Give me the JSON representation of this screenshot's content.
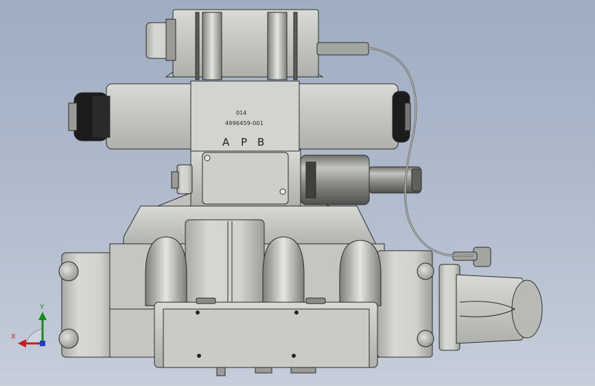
{
  "labels": {
    "part_line_1": "014",
    "part_line_2": "4996459-001",
    "port_a": "A",
    "port_p": "P",
    "port_b": "B"
  },
  "axes": {
    "y": "Y",
    "x": "X"
  },
  "colors": {
    "background_top": "#9fadc2",
    "background_bottom": "#c6ceda",
    "metal": "#c9cbc7",
    "edge": "#2a2a2a",
    "axis_x": "#c21e1e",
    "axis_y": "#1a8a1a",
    "axis_z": "#1f3fbf"
  }
}
